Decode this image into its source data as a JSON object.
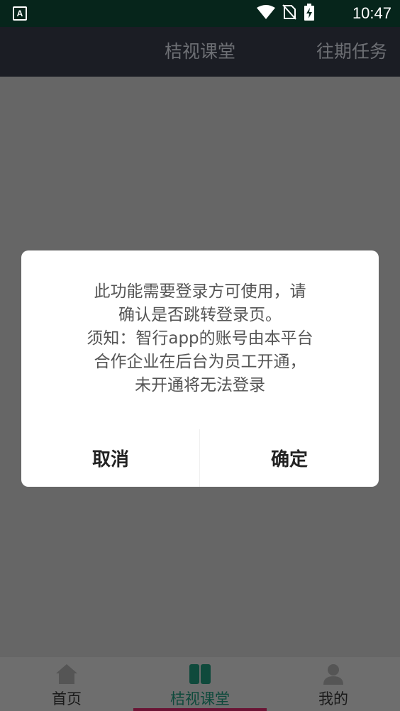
{
  "status_bar": {
    "app_icon_letter": "A",
    "time": "10:47"
  },
  "header": {
    "title": "桔视课堂",
    "action": "往期任务"
  },
  "dialog": {
    "message": "此功能需要登录方可使用，请\n确认是否跳转登录页。\n须知：智行app的账号由本平台\n合作企业在后台为员工开通，\n未开通将无法登录",
    "cancel_label": "取消",
    "confirm_label": "确定"
  },
  "bottom_nav": {
    "items": [
      {
        "label": "首页",
        "icon": "home-icon",
        "active": false
      },
      {
        "label": "桔视课堂",
        "icon": "book-icon",
        "active": true
      },
      {
        "label": "我的",
        "icon": "person-icon",
        "active": false
      }
    ]
  },
  "colors": {
    "status_bar": "#06251b",
    "header": "#1b1d24",
    "overlay_background": "#666666",
    "active_nav_icon": "#0f4a3c",
    "active_indicator": "#6a1434"
  }
}
